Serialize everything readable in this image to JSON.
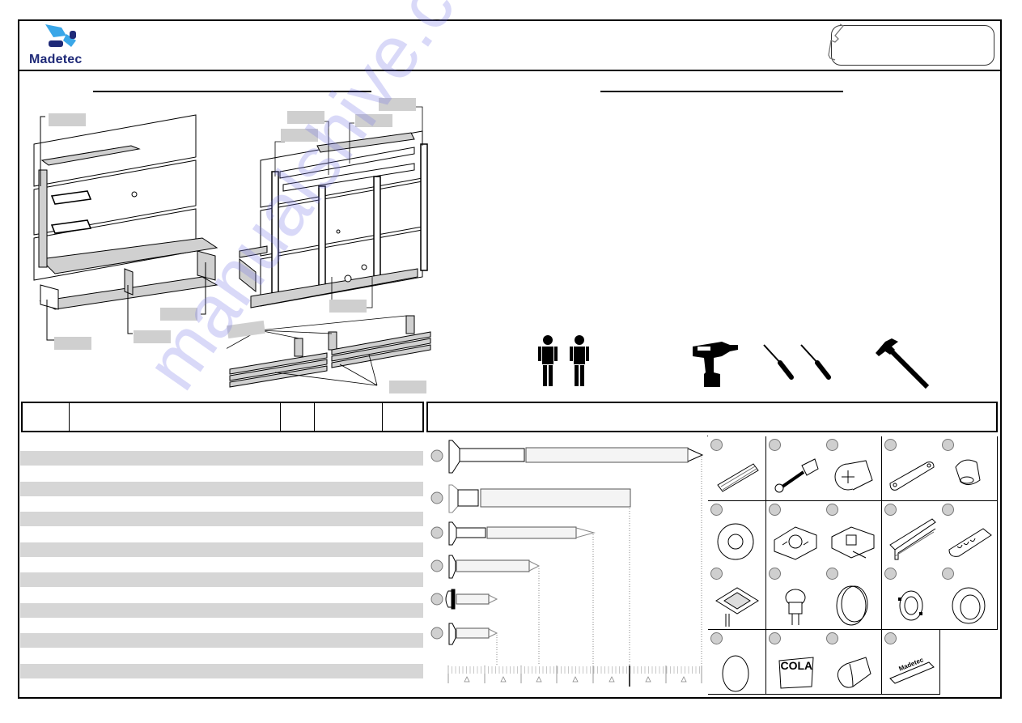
{
  "brand": {
    "name": "Madetec",
    "logo_colors": {
      "light": "#3aa7e8",
      "dark": "#1f2a78"
    }
  },
  "header": {
    "phone_icon": "phone-icon",
    "contact_box_text": ""
  },
  "sections": {
    "left_title": "",
    "right_title": ""
  },
  "diagram_labels": {
    "left_view": [
      "",
      "",
      "",
      ""
    ],
    "right_view": [
      "",
      "",
      "",
      "",
      "",
      "",
      ""
    ]
  },
  "tools": [
    {
      "icon": "person-icon"
    },
    {
      "icon": "person-icon"
    },
    {
      "icon": "drill-icon"
    },
    {
      "icon": "screwdriver-icon"
    },
    {
      "icon": "screwdriver-icon"
    },
    {
      "icon": "hammer-icon"
    }
  ],
  "parts_table": {
    "columns": [
      "",
      "",
      "",
      "",
      ""
    ],
    "rows": [
      "",
      "",
      "",
      "",
      "",
      "",
      "",
      ""
    ]
  },
  "hardware_header": {
    "text": ""
  },
  "screws": [
    {
      "id": "",
      "type": "long-wood-screw"
    },
    {
      "id": "",
      "type": "confirmat-screw"
    },
    {
      "id": "",
      "type": "wood-screw-medium"
    },
    {
      "id": "",
      "type": "wood-screw-short"
    },
    {
      "id": "",
      "type": "pan-head-screw"
    },
    {
      "id": "",
      "type": "flat-head-screw-small"
    }
  ],
  "hardware_items": [
    {
      "id": "",
      "name": "dowel-icon"
    },
    {
      "id": "",
      "name": "cam-bolt-icon"
    },
    {
      "id": "",
      "name": "cam-lock-icon"
    },
    {
      "id": "",
      "name": "flat-bracket-icon"
    },
    {
      "id": "",
      "name": "shelf-support-icon"
    },
    {
      "id": "",
      "name": "spacer-ring-icon"
    },
    {
      "id": "",
      "name": "hanger-bracket-left-icon"
    },
    {
      "id": "",
      "name": "hanger-bracket-right-icon"
    },
    {
      "id": "",
      "name": "rail-profile-icon"
    },
    {
      "id": "",
      "name": "wall-plug-icon"
    },
    {
      "id": "",
      "name": "led-spot-icon"
    },
    {
      "id": "",
      "name": "switch-icon"
    },
    {
      "id": "",
      "name": "cap-icon"
    },
    {
      "id": "",
      "name": "lamp-ring-icon"
    },
    {
      "id": "",
      "name": "grommet-icon"
    },
    {
      "id": "",
      "name": "cover-disc-icon"
    },
    {
      "id": "",
      "name": "glue-pack-icon",
      "label": "COLA"
    },
    {
      "id": "",
      "name": "bumper-icon"
    },
    {
      "id": "",
      "name": "brand-plate-icon",
      "label": "Madetec"
    }
  ],
  "ruler": {
    "marks": 7
  },
  "watermark": "manualshive.com"
}
